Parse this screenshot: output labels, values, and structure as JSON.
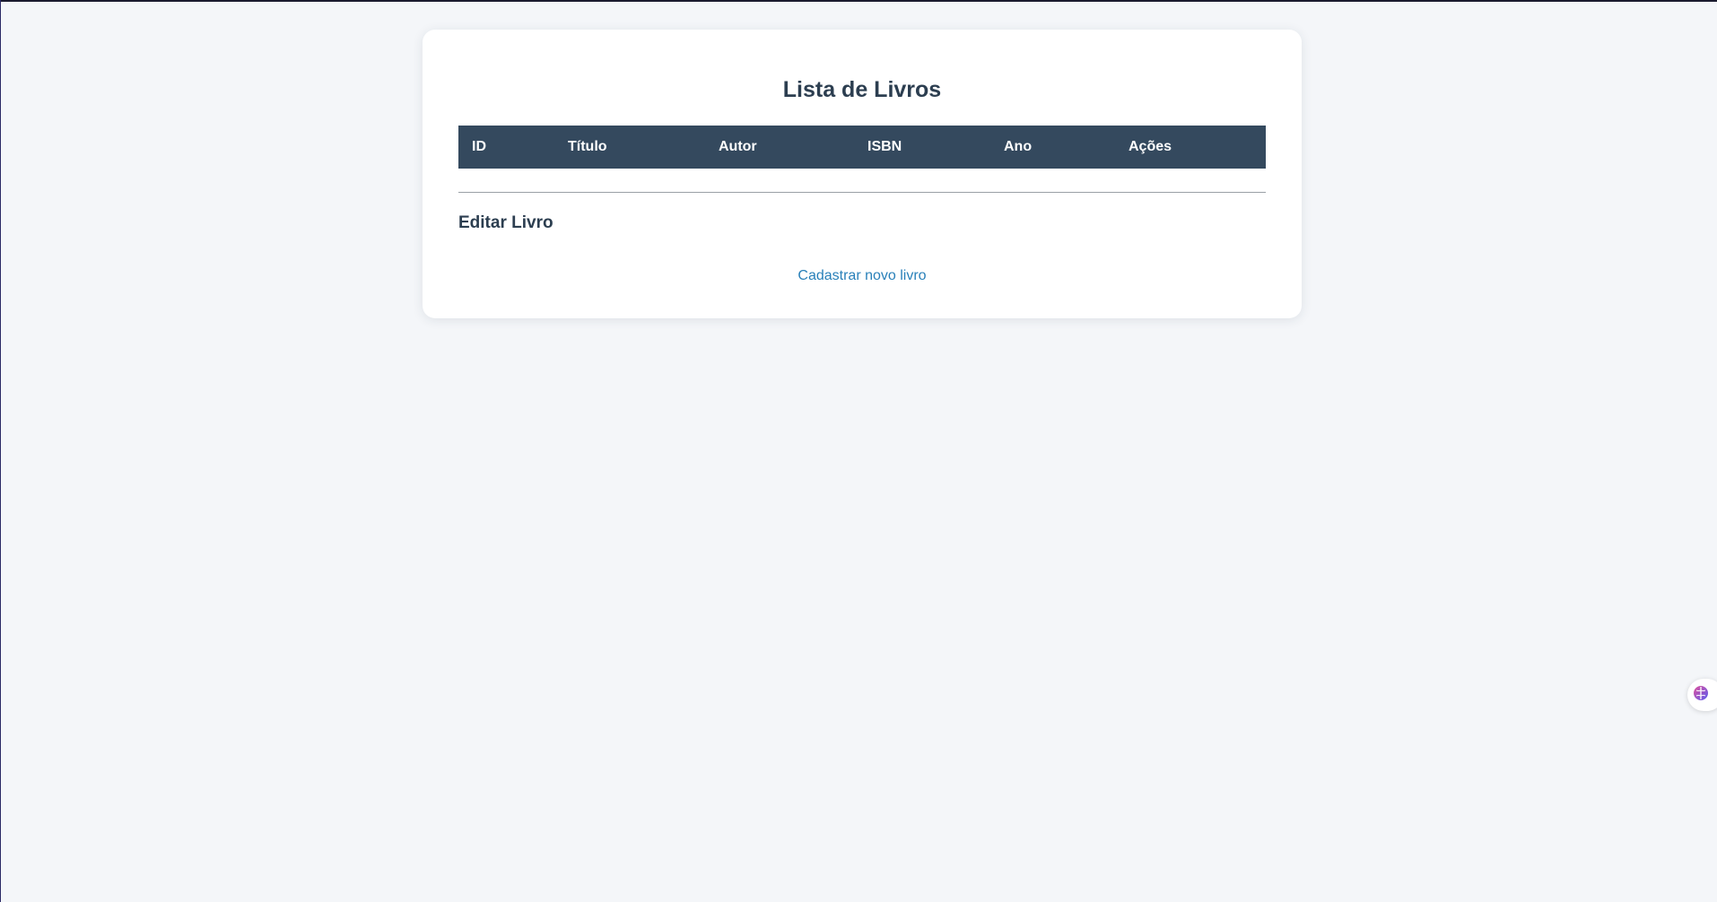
{
  "page": {
    "title": "Lista de Livros"
  },
  "table": {
    "columns": [
      "ID",
      "Título",
      "Autor",
      "ISBN",
      "Ano",
      "Ações"
    ],
    "rows": []
  },
  "edit_section": {
    "title": "Editar Livro"
  },
  "links": {
    "new_book": "Cadastrar novo livro"
  },
  "widget": {
    "icon": "brain-icon"
  },
  "colors": {
    "background": "#f4f6f9",
    "card": "#ffffff",
    "header_bg": "#34495e",
    "title_text": "#2c3e50",
    "link": "#2980b9"
  }
}
